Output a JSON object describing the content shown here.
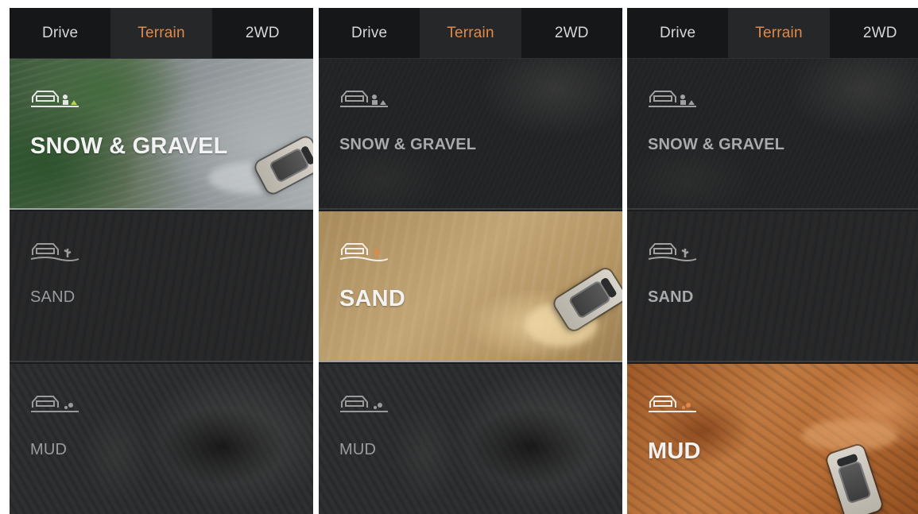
{
  "tabs": [
    "Drive",
    "Terrain",
    "2WD"
  ],
  "active_tab_index": 1,
  "accent_color": "#e08a4a",
  "terrain_modes": [
    {
      "label": "SNOW & GRAVEL",
      "icon": "car-snow-gravel-icon"
    },
    {
      "label": "SAND",
      "icon": "car-sand-icon"
    },
    {
      "label": "MUD",
      "icon": "car-mud-icon"
    }
  ],
  "screens": [
    {
      "selected_mode": "SNOW & GRAVEL"
    },
    {
      "selected_mode": "SAND"
    },
    {
      "selected_mode": "MUD"
    }
  ],
  "p0": {
    "tabs": {
      "drive": "Drive",
      "terrain": "Terrain",
      "twowd": "2WD"
    },
    "modes": {
      "snow": "SNOW & GRAVEL",
      "sand": "SAND",
      "mud": "MUD"
    }
  },
  "p1": {
    "tabs": {
      "drive": "Drive",
      "terrain": "Terrain",
      "twowd": "2WD"
    },
    "modes": {
      "snow": "SNOW & GRAVEL",
      "sand": "SAND",
      "mud": "MUD"
    }
  },
  "p2": {
    "tabs": {
      "drive": "Drive",
      "terrain": "Terrain",
      "twowd": "2WD"
    },
    "modes": {
      "snow": "SNOW & GRAVEL",
      "sand": "SAND",
      "mud": "MUD"
    }
  }
}
